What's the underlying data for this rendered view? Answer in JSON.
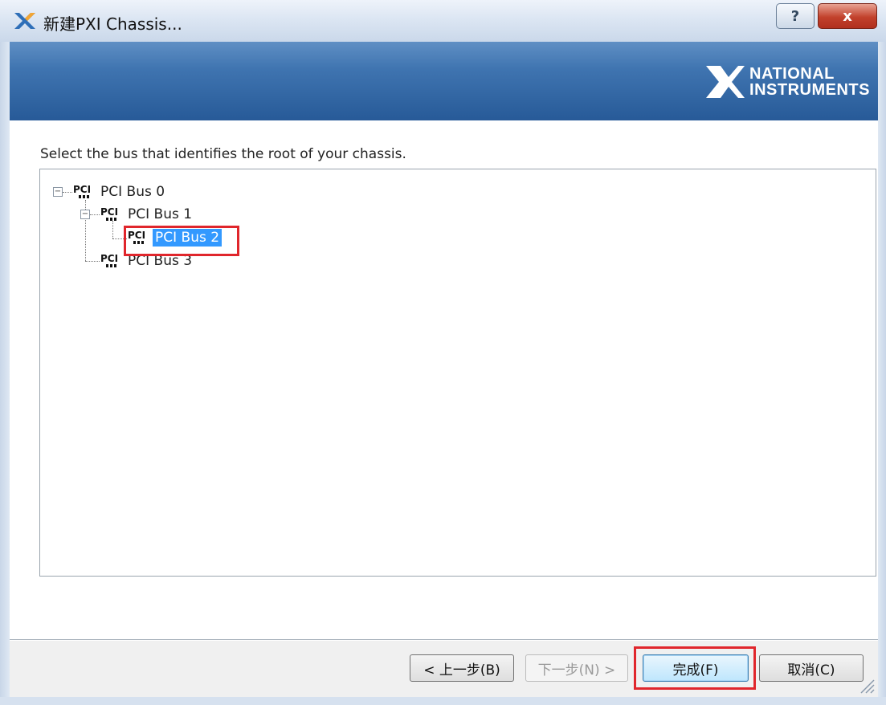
{
  "window": {
    "title": "新建PXI Chassis...",
    "help_glyph": "?",
    "close_glyph": "x"
  },
  "brand": {
    "line1": "NATIONAL",
    "line2": "INSTRUMENTS"
  },
  "instruction": "Select the bus that identifies the root of your chassis.",
  "tree": {
    "items": [
      {
        "label": "PCI Bus 0",
        "level": 0,
        "expanded": true,
        "selected": false,
        "icon": "pci-bus-icon"
      },
      {
        "label": "PCI Bus 1",
        "level": 1,
        "expanded": true,
        "selected": false,
        "icon": "pci-bus-icon"
      },
      {
        "label": "PCI Bus 2",
        "level": 2,
        "expanded": false,
        "selected": true,
        "icon": "pci-bus-icon"
      },
      {
        "label": "PCI Bus 3",
        "level": 1,
        "expanded": false,
        "selected": false,
        "icon": "pci-bus-icon"
      }
    ],
    "expander_collapse_glyph": "−"
  },
  "buttons": {
    "back": "< 上一步(B)",
    "next": "下一步(N) >",
    "finish": "完成(F)",
    "cancel": "取消(C)"
  },
  "colors": {
    "highlight": "#e0262c",
    "selection": "#3399ff",
    "header": "#3f74b0"
  }
}
